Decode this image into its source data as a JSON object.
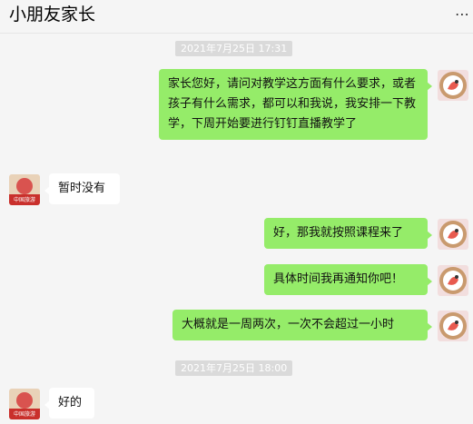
{
  "chat": {
    "title": "小朋友家长",
    "more_icon": "ellipsis-icon"
  },
  "timestamps": [
    "2021年7月25日 17:31",
    "2021年7月25日 18:00"
  ],
  "messages": [
    {
      "from": "me",
      "text": "家长您好，请问对教学这方面有什么要求，或者孩子有什么需求，都可以和我说，我安排一下教学，下周开始要进行钉钉直播教学了"
    },
    {
      "from": "other",
      "text": "暂时没有"
    },
    {
      "from": "me",
      "text": "好，那我就按照课程来了"
    },
    {
      "from": "me",
      "text": "具体时间我再通知你吧！"
    },
    {
      "from": "me",
      "text": "大概就是一周两次，一次不会超过一小时"
    },
    {
      "from": "other",
      "text": "好的"
    }
  ],
  "other_avatar": {
    "logo_text": "中国旅游"
  },
  "colors": {
    "my_bubble": "#95ec69",
    "other_bubble": "#ffffff",
    "background": "#f5f5f5",
    "timestamp_bg": "#dadada"
  }
}
